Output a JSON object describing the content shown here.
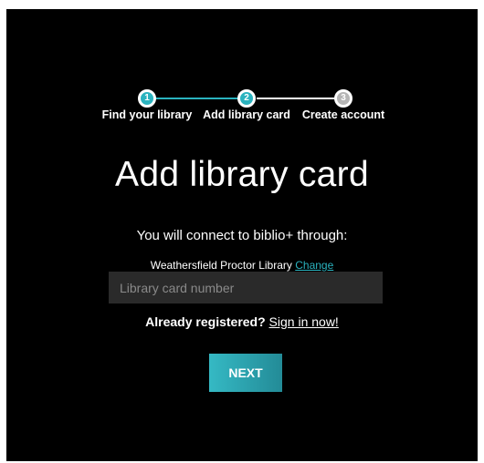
{
  "stepper": {
    "steps": [
      {
        "number": "1",
        "label": "Find your library",
        "state": "done"
      },
      {
        "number": "2",
        "label": "Add library card",
        "state": "current"
      },
      {
        "number": "3",
        "label": "Create account",
        "state": "future"
      }
    ]
  },
  "main": {
    "title": "Add library card",
    "connect_text": "You will connect to biblio+ through:",
    "library_name": "Weathersfield Proctor Library",
    "change_label": "Change",
    "card_input": {
      "placeholder": "Library card number",
      "value": ""
    },
    "registered_text": "Already registered?",
    "signin_label": "Sign in now!",
    "next_label": "NEXT"
  },
  "colors": {
    "accent": "#2ab3bf",
    "background": "#000000",
    "input_bg": "#2a2a2a"
  }
}
